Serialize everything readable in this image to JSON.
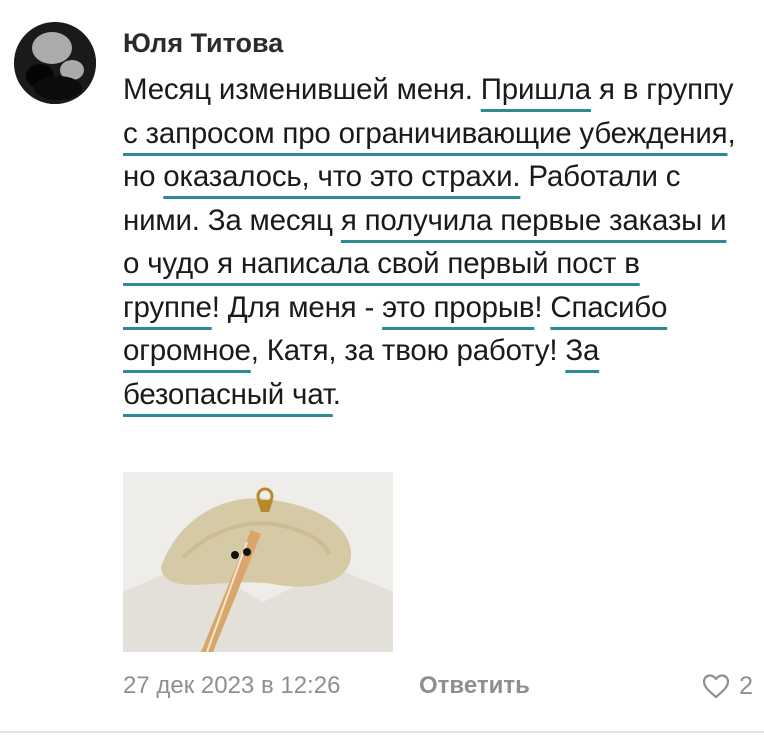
{
  "comment": {
    "author": "Юля Титова",
    "segments": [
      {
        "text": "Месяц изменившей меня. ",
        "hl": false
      },
      {
        "text": "Пришла",
        "hl": true
      },
      {
        "text": " я в группу ",
        "hl": false
      },
      {
        "text": "с запросом про ограничивающие убеждения",
        "hl": true
      },
      {
        "text": ", но ",
        "hl": false
      },
      {
        "text": "оказалось, что это страхи.",
        "hl": true
      },
      {
        "text": " Работали с ними. За месяц ",
        "hl": false
      },
      {
        "text": "я получила первые заказы и о чудо я написала свой первый пост в группе",
        "hl": true
      },
      {
        "text": "! Для меня - ",
        "hl": false
      },
      {
        "text": "это прорыв",
        "hl": true
      },
      {
        "text": "! ",
        "hl": false
      },
      {
        "text": "Спасибо огромное",
        "hl": true
      },
      {
        "text": ", Катя, за твою работу! ",
        "hl": false
      },
      {
        "text": "За безопасный чат",
        "hl": true
      },
      {
        "text": ".",
        "hl": false
      }
    ],
    "date": "27 дек 2023 в 12:26",
    "reply_label": "Ответить",
    "likes": "2",
    "like_icon": "heart-outline-icon"
  },
  "colors": {
    "underline": "#2b8a95",
    "meta_text": "#8c8f94",
    "body_text": "#1a1a1a"
  }
}
